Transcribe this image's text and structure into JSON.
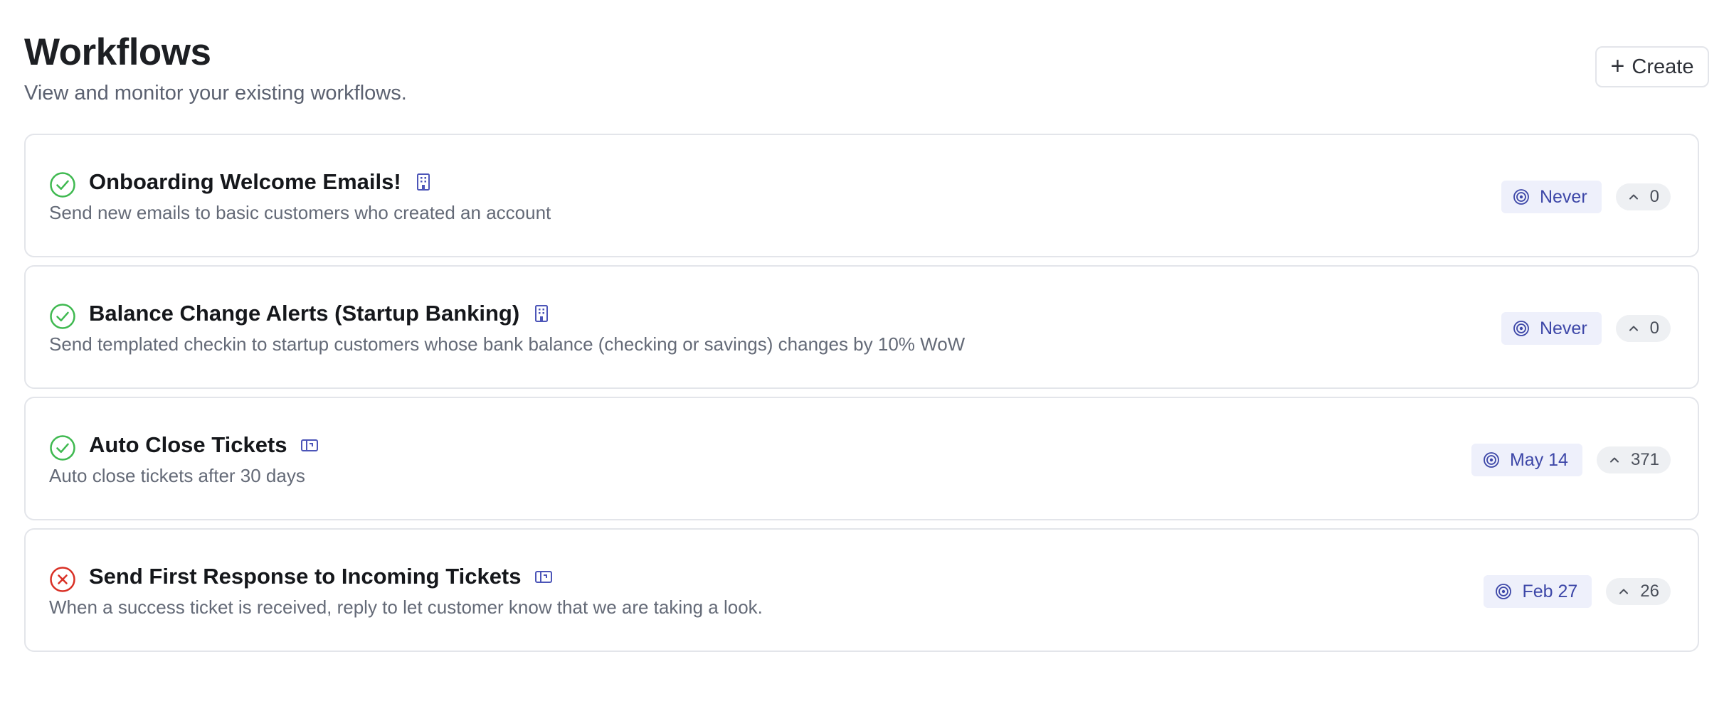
{
  "header": {
    "title": "Workflows",
    "subtitle": "View and monitor your existing workflows.",
    "create_label": "Create"
  },
  "colors": {
    "success": "#3fb950",
    "error": "#d93025",
    "accent": "#3d47a8",
    "badge_bg": "#eef0fb"
  },
  "workflows": [
    {
      "status": "success",
      "status_icon": "check-circle-icon",
      "title": "Onboarding Welcome Emails!",
      "type_icon": "building-icon",
      "description": "Send new emails to basic customers who created an account",
      "last_run": "Never",
      "count": "0"
    },
    {
      "status": "success",
      "status_icon": "check-circle-icon",
      "title": "Balance Change Alerts (Startup Banking)",
      "type_icon": "building-icon",
      "description": "Send templated checkin to startup customers whose bank balance (checking or savings) changes by 10% WoW",
      "last_run": "Never",
      "count": "0"
    },
    {
      "status": "success",
      "status_icon": "check-circle-icon",
      "title": "Auto Close Tickets",
      "type_icon": "ticket-icon",
      "description": "Auto close tickets after 30 days",
      "last_run": "May 14",
      "count": "371"
    },
    {
      "status": "error",
      "status_icon": "x-circle-icon",
      "title": "Send First Response to Incoming Tickets",
      "type_icon": "ticket-icon",
      "description": "When a success ticket is received, reply to let customer know that we are taking a look.",
      "last_run": "Feb 27",
      "count": "26"
    }
  ]
}
